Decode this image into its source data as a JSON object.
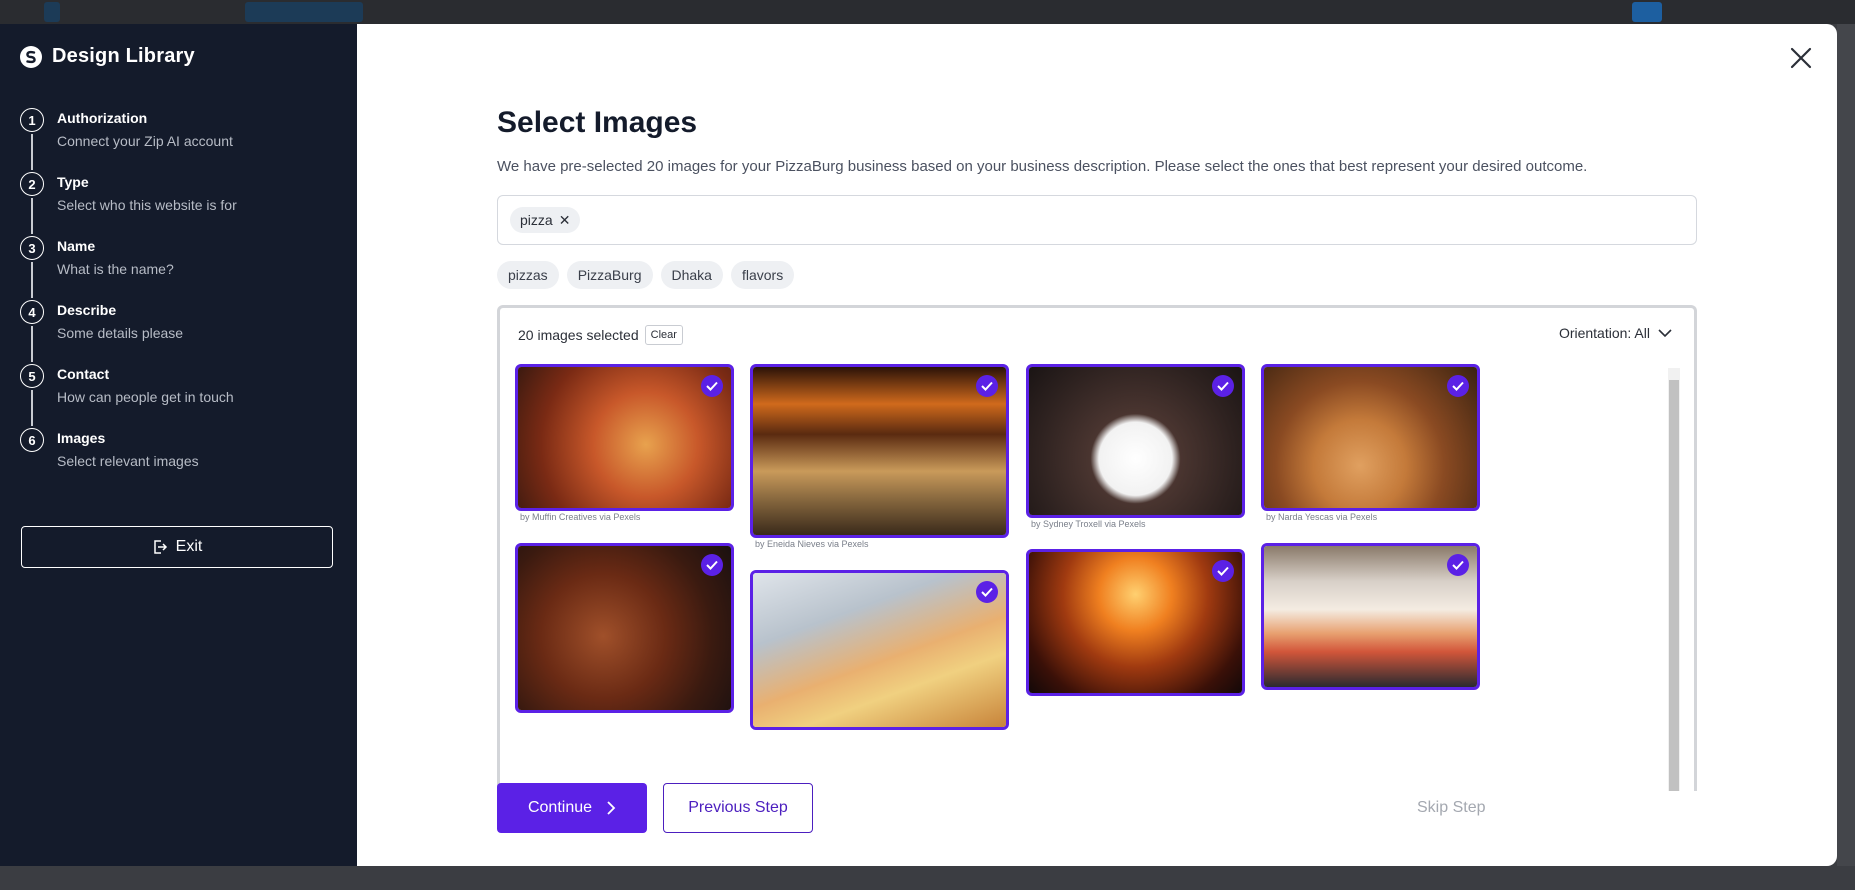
{
  "sidebar": {
    "brand": "Design Library",
    "steps": [
      {
        "num": "1",
        "title": "Authorization",
        "desc": "Connect your Zip AI account"
      },
      {
        "num": "2",
        "title": "Type",
        "desc": "Select who this website is for"
      },
      {
        "num": "3",
        "title": "Name",
        "desc": "What is the name?"
      },
      {
        "num": "4",
        "title": "Describe",
        "desc": "Some details please"
      },
      {
        "num": "5",
        "title": "Contact",
        "desc": "How can people get in touch"
      },
      {
        "num": "6",
        "title": "Images",
        "desc": "Select relevant images"
      }
    ],
    "exit_label": "Exit"
  },
  "main": {
    "title": "Select Images",
    "subtitle": "We have pre-selected 20 images for your PizzaBurg business based on your business description. Please select the ones that best represent your desired outcome.",
    "search_chip": "pizza",
    "suggestions": [
      "pizzas",
      "PizzaBurg",
      "Dhaka",
      "flavors"
    ],
    "selected_text": "20 images selected",
    "clear_label": "Clear",
    "orientation_label": "Orientation: All",
    "credits": [
      "by Muffin Creatives via Pexels",
      "by Eneida Nieves via Pexels",
      "by Sydney Troxell via Pexels",
      "by Narda Yescas via Pexels"
    ],
    "continue_label": "Continue",
    "previous_label": "Previous Step",
    "skip_label": "Skip Step"
  },
  "colors": {
    "accent": "#5b21e6",
    "sidebar_bg": "#141b2b"
  }
}
